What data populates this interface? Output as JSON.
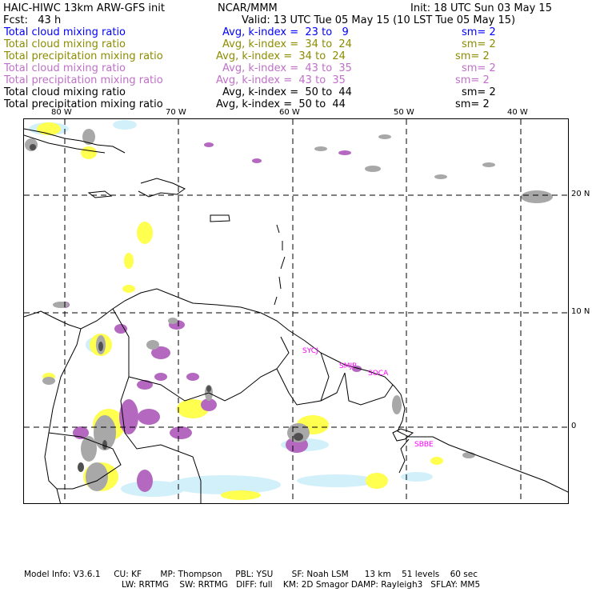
{
  "header": {
    "title": "HAIC-HIWC 13km ARW-GFS init",
    "org": "NCAR/MMM",
    "init": "Init: 18 UTC Sun 03 May 15",
    "fcst": "Fcst:   43 h",
    "valid": "Valid: 13 UTC Tue 05 May 15 (10 LST Tue 05 May 15)"
  },
  "fields": [
    {
      "name": "Total cloud mixing ratio",
      "avg": "Avg, k-index =  23 to   9",
      "sm": "sm= 2",
      "color": "#0000ff"
    },
    {
      "name": "Total cloud mixing ratio",
      "avg": "Avg, k-index =  34 to  24",
      "sm": "sm= 2",
      "color": "#8c8c00"
    },
    {
      "name": "Total precipitation mixing ratio",
      "avg": "Avg, k-index =  34 to  24",
      "sm": "sm= 2",
      "color": "#8c8c00"
    },
    {
      "name": "Total cloud mixing ratio",
      "avg": "Avg, k-index =  43 to  35",
      "sm": "sm= 2",
      "color": "#c070c8"
    },
    {
      "name": "Total precipitation mixing ratio",
      "avg": "Avg, k-index =  43 to  35",
      "sm": "sm= 2",
      "color": "#c070c8"
    },
    {
      "name": "Total cloud mixing ratio",
      "avg": "Avg, k-index =  50 to  44",
      "sm": "sm= 2",
      "color": "#000000"
    },
    {
      "name": "Total precipitation mixing ratio",
      "avg": "Avg, k-index =  50 to  44",
      "sm": "sm= 2",
      "color": "#000000"
    }
  ],
  "axes": {
    "lon_labels": [
      "80 W",
      "70 W",
      "60 W",
      "50 W",
      "40 W"
    ],
    "lat_labels": [
      "20 N",
      "10 N",
      "0"
    ]
  },
  "stations": [
    "SYCJ",
    "SMJP",
    "SOCA",
    "SBBE"
  ],
  "footer": {
    "line1": "Model Info: V3.6.1     CU: KF       MP: Thompson     PBL: YSU       SF: Noah LSM      13 km    51 levels    60 sec",
    "line2": "LW: RRTMG    SW: RRTMG   DIFF: full    KM: 2D Smagor DAMP: Rayleigh3   SFLAY: MM5"
  },
  "colors": {
    "yellow": "#ffff50",
    "lightblue": "#d2f0fa",
    "purple": "#b468c0",
    "gray": "#a8a8a8",
    "darkgray": "#505050"
  }
}
